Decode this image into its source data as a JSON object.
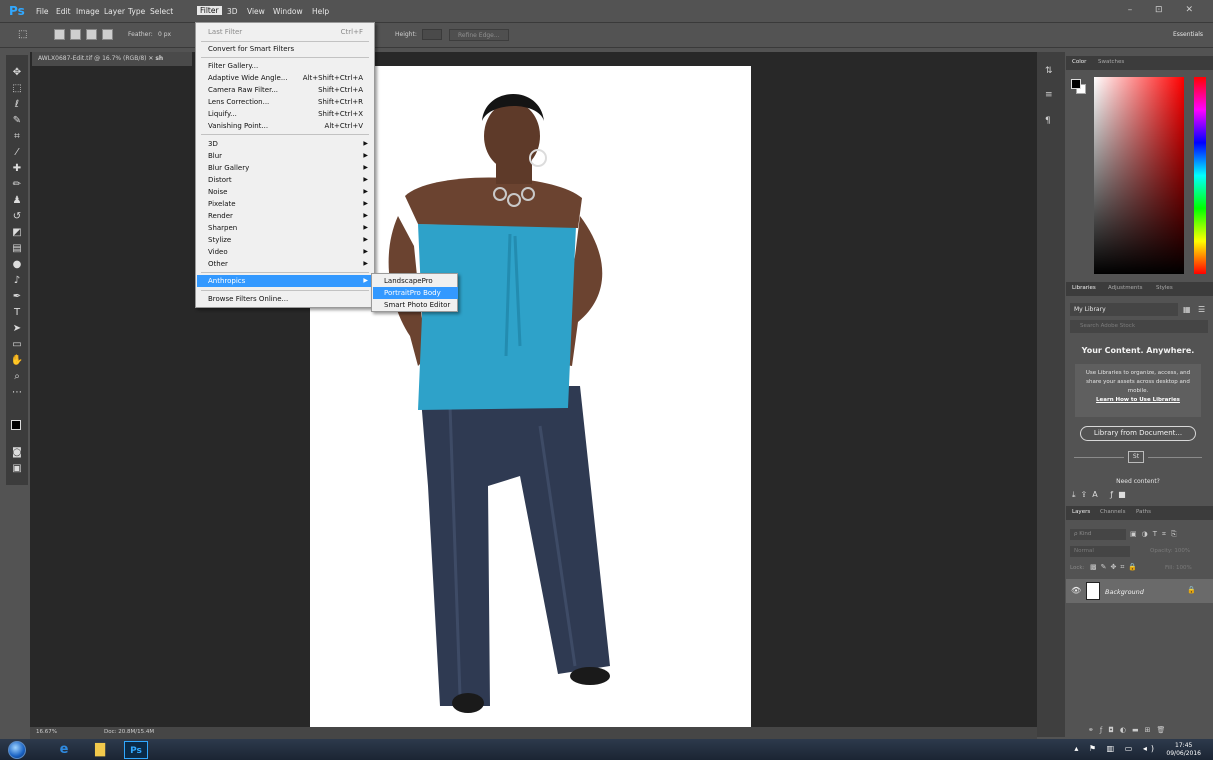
{
  "app": {
    "logo": "Ps",
    "menus": [
      "File",
      "Edit",
      "Image",
      "Layer",
      "Type",
      "Select",
      "Filter",
      "3D",
      "View",
      "Window",
      "Help"
    ],
    "window_controls": "– ⊡ ✕"
  },
  "options_bar": {
    "feather_label": "Feather:",
    "feather_value": "0 px",
    "height_label": "Height:",
    "refine_edge": "Refine Edge...",
    "workspace": "Essentials"
  },
  "document": {
    "tab_title": "AWLX0687-Edit.tif @ 16.7% (RGB/8)",
    "second_tab": "sh",
    "zoom": "16.67%",
    "doc_size": "Doc: 20.8M/15.4M"
  },
  "filter_menu": {
    "last_filter": "Last Filter",
    "last_filter_shortcut": "Ctrl+F",
    "convert_smart": "Convert for Smart Filters",
    "group1": [
      {
        "label": "Filter Gallery...",
        "shortcut": ""
      },
      {
        "label": "Adaptive Wide Angle...",
        "shortcut": "Alt+Shift+Ctrl+A"
      },
      {
        "label": "Camera Raw Filter...",
        "shortcut": "Shift+Ctrl+A"
      },
      {
        "label": "Lens Correction...",
        "shortcut": "Shift+Ctrl+R"
      },
      {
        "label": "Liquify...",
        "shortcut": "Shift+Ctrl+X"
      },
      {
        "label": "Vanishing Point...",
        "shortcut": "Alt+Ctrl+V"
      }
    ],
    "group2": [
      "3D",
      "Blur",
      "Blur Gallery",
      "Distort",
      "Noise",
      "Pixelate",
      "Render",
      "Sharpen",
      "Stylize",
      "Video",
      "Other"
    ],
    "anthropics": "Anthropics",
    "browse_online": "Browse Filters Online..."
  },
  "submenu": [
    "LandscapePro",
    "PortraitPro Body",
    "Smart Photo Editor"
  ],
  "color_panel": {
    "tabs": [
      "Color",
      "Swatches"
    ]
  },
  "libraries_panel": {
    "tabs": [
      "Libraries",
      "Adjustments",
      "Styles"
    ],
    "library": "My Library",
    "search_placeholder": "Search Adobe Stock",
    "heading": "Your Content. Anywhere.",
    "promo": "Use Libraries to organize, access, and share your assets across desktop and mobile.",
    "link": "Learn How to Use Libraries",
    "from_document": "Library from Document...",
    "st_badge": "St",
    "need_content": "Need content?"
  },
  "layers_panel": {
    "tabs": [
      "Layers",
      "Channels",
      "Paths"
    ],
    "search": "ρ Kind",
    "blend_mode": "Normal",
    "opacity": "Opacity: 100%",
    "lock": "Lock:",
    "fill": "Fill: 100%",
    "layer_name": "Background"
  },
  "taskbar": {
    "time": "17:45",
    "date": "09/06/2016"
  },
  "colors": {
    "accent": "#3399ff",
    "shirt": "#2ea2c9",
    "jeans": "#2f3a52"
  }
}
